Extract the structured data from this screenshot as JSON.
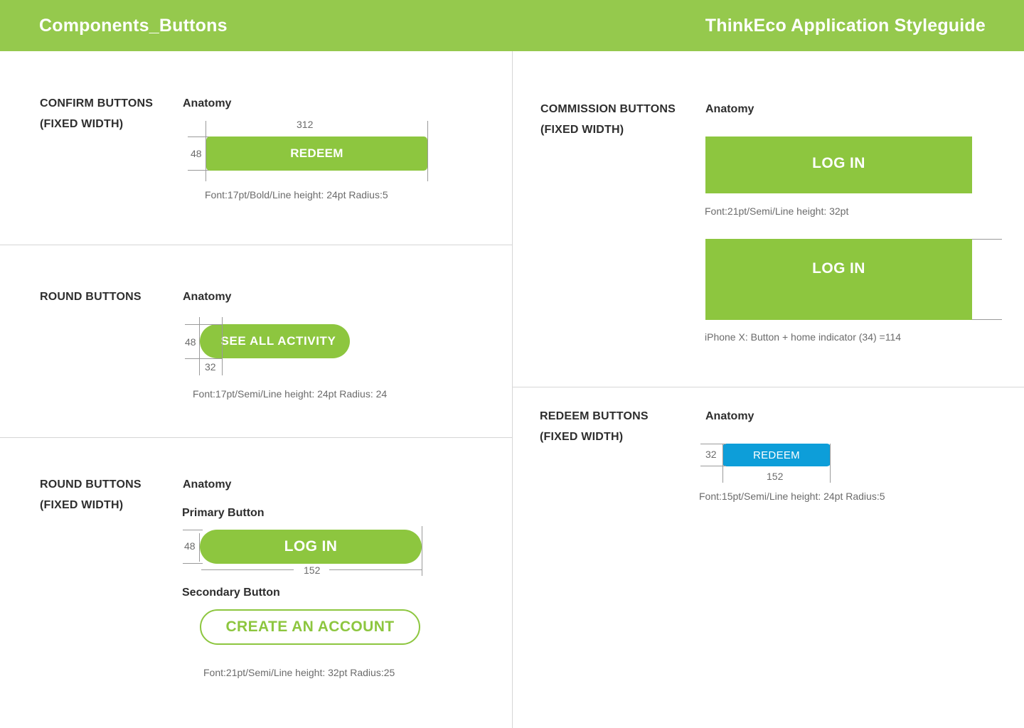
{
  "header": {
    "left_title": "Components_Buttons",
    "right_title": "ThinkEco Application Styleguide"
  },
  "colors": {
    "brand_green": "#8dc63f",
    "header_green": "#95c94d",
    "redeem_blue": "#0d9ed9",
    "divider": "#d6d6d6"
  },
  "confirm": {
    "label_line1": "CONFIRM BUTTONS",
    "label_line2": "(FIXED WIDTH)",
    "anatomy": "Anatomy",
    "width_dim": "312",
    "height_dim": "48",
    "button_label": "REDEEM",
    "spec": "Font:17pt/Bold/Line height: 24pt Radius:5"
  },
  "round": {
    "label": "ROUND BUTTONS",
    "anatomy": "Anatomy",
    "height_dim": "48",
    "padding_dim": "32",
    "button_label": "SEE ALL ACTIVITY",
    "spec": "Font:17pt/Semi/Line height: 24pt Radius: 24"
  },
  "round_fixed": {
    "label_line1": "ROUND BUTTONS",
    "label_line2": "(FIXED WIDTH)",
    "anatomy": "Anatomy",
    "primary_label": "Primary Button",
    "height_dim": "48",
    "primary_button": "LOG IN",
    "width_dim": "152",
    "secondary_label": "Secondary Button",
    "secondary_button": "CREATE AN ACCOUNT",
    "spec": "Font:21pt/Semi/Line height: 32pt Radius:25"
  },
  "commission": {
    "label_line1": "COMMISSION BUTTONS",
    "label_line2": "(FIXED WIDTH)",
    "anatomy": "Anatomy",
    "button1_label": "LOG IN",
    "spec1": "Font:21pt/Semi/Line height: 32pt",
    "button2_label": "LOG IN",
    "spec2": "iPhone X: Button + home indicator (34) =114"
  },
  "redeem": {
    "label_line1": "REDEEM BUTTONS",
    "label_line2": "(FIXED WIDTH)",
    "anatomy": "Anatomy",
    "height_dim": "32",
    "button_label": "REDEEM",
    "width_dim": "152",
    "spec": "Font:15pt/Semi/Line height: 24pt Radius:5"
  }
}
